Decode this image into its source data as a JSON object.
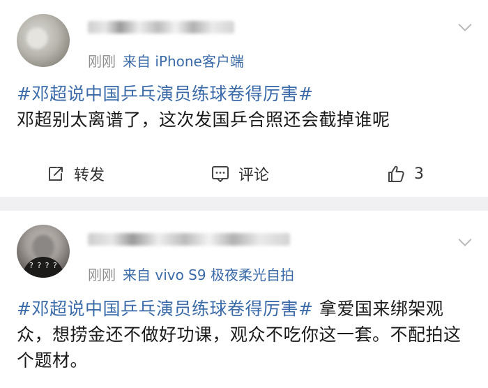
{
  "posts": [
    {
      "meta": {
        "time": "刚刚",
        "source": "来自 iPhone客户端"
      },
      "hashtag": "#邓超说中国乒乓演员练球卷得厉害#",
      "text": "邓超别太离谱了，这次发国乒合照还会截掉谁呢",
      "actions": {
        "repost": "转发",
        "comment": "评论",
        "like_count": "3"
      }
    },
    {
      "meta": {
        "time": "刚刚",
        "source": "来自 vivo S9 极夜柔光自拍"
      },
      "hashtag": "#邓超说中国乒乓演员练球卷得厉害#",
      "text": " 拿爱国来绑架观众，想捞金还不做好功课，观众不吃你这一套。不配拍这个题材。",
      "avatar_marks": "? ? ? ?"
    }
  ],
  "icons": {
    "chevron": "chevron-down-icon",
    "repost": "repost-icon",
    "comment": "comment-icon",
    "like": "thumbs-up-icon"
  },
  "colors": {
    "link": "#3b6aa8",
    "meta": "#8d8d8d",
    "separator": "#f0f0f2"
  }
}
